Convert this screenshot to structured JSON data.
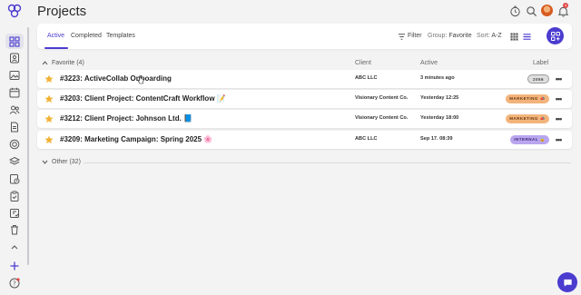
{
  "page": {
    "title": "Projects"
  },
  "sidebar": {
    "icons": [
      "logo-icon",
      "grid-icon",
      "contacts-icon",
      "image-icon",
      "calendar-icon",
      "people-icon",
      "document-icon",
      "target-icon",
      "layers-icon",
      "timesheet-icon",
      "clipboard-icon",
      "invoice-icon",
      "trash-icon",
      "collapse-icon",
      "plus-icon",
      "help-icon"
    ]
  },
  "header": {
    "icons": [
      "timer-icon",
      "search-icon",
      "avatar",
      "bell-icon"
    ],
    "notification_count": "4"
  },
  "tabs": [
    {
      "label": "Active",
      "active": true
    },
    {
      "label": "Completed",
      "active": false
    },
    {
      "label": "Templates",
      "active": false
    }
  ],
  "toolbar": {
    "filter_label": "Filter",
    "group_prefix": "Group:",
    "group_value": "Favorite",
    "sort_prefix": "Sort:",
    "sort_value": "A-Z"
  },
  "columns": {
    "client": "Client",
    "active": "Active",
    "label": "Label"
  },
  "groups": [
    {
      "title": "Favorite (4)",
      "expanded": true
    },
    {
      "title": "Other (32)",
      "expanded": false
    }
  ],
  "projects": [
    {
      "name": "#3223: ActiveCollab Onboarding",
      "client": "ABC LLC",
      "active": "3 minutes ago",
      "label": "2056",
      "label_bg": "#dedede",
      "label_fg": "#444",
      "label_border": "#9a9a9a"
    },
    {
      "name": "#3203: Client Project: ContentCraft Workflow 📝",
      "client": "Visionary Content Co.",
      "active": "Yesterday 12:25",
      "label": "MARKETING 📣",
      "label_bg": "#f3b47b",
      "label_fg": "#6b3a12",
      "label_border": "#f3b47b"
    },
    {
      "name": "#3212: Client Project: Johnson Ltd. 📘",
      "client": "Visionary Content Co.",
      "active": "Yesterday 18:00",
      "label": "MARKETING 📣",
      "label_bg": "#f3b47b",
      "label_fg": "#6b3a12",
      "label_border": "#f3b47b"
    },
    {
      "name": "#3209: Marketing Campaign: Spring 2025 🌸",
      "client": "ABC LLC",
      "active": "Sep 17. 08:39",
      "label": "INTERNAL 🔒",
      "label_bg": "#b9a6ee",
      "label_fg": "#3b2a7a",
      "label_border": "#b9a6ee"
    }
  ],
  "colors": {
    "accent": "#4b3ccf",
    "star": "#f2b133",
    "background": "#f3f3f4"
  }
}
